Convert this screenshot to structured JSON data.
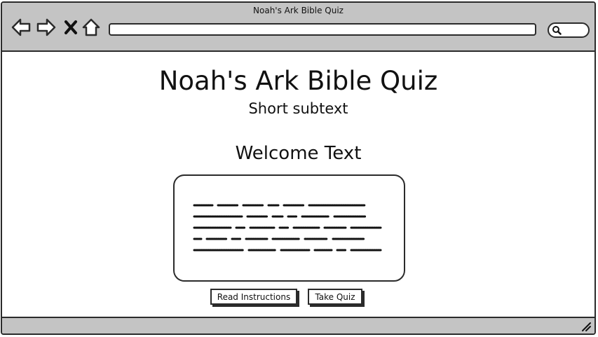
{
  "window": {
    "title": "Noah's Ark Bible Quiz",
    "address": "",
    "search": ""
  },
  "toolbar": {
    "back_icon": "back-arrow-icon",
    "forward_icon": "forward-arrow-icon",
    "stop_icon": "close-x-icon",
    "home_icon": "home-icon",
    "search_icon": "search-icon"
  },
  "page": {
    "title": "Noah's Ark Bible Quiz",
    "subtitle": "Short subtext",
    "welcome": "Welcome Text",
    "card_text_lines": 5
  },
  "buttons": {
    "read_instructions": "Read Instructions",
    "take_quiz": "Take Quiz"
  },
  "colors": {
    "chrome": "#c4c4c4",
    "stroke": "#2b2b2b",
    "background": "#ffffff"
  }
}
